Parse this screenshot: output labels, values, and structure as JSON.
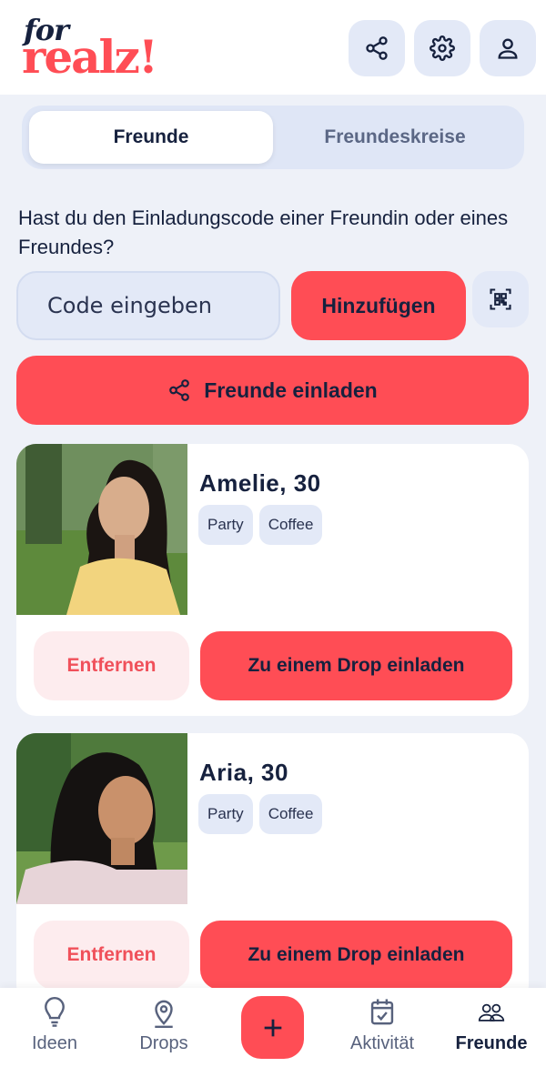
{
  "brand": {
    "line1": "for",
    "line2": "realz!"
  },
  "header": {
    "actions": [
      {
        "icon": "share-icon"
      },
      {
        "icon": "gear-icon"
      },
      {
        "icon": "user-icon"
      }
    ]
  },
  "tabs": {
    "friends": "Freunde",
    "circles": "Freundeskreise",
    "active": "Freunde"
  },
  "invite_section": {
    "prompt": "Hast du den Einladungscode einer Freundin oder eines Freundes?",
    "code_placeholder": "Code eingeben",
    "add_label": "Hinzufügen",
    "invite_label": "Freunde einladen"
  },
  "friends": [
    {
      "name": "Amelie, 30",
      "tags": [
        "Party",
        "Coffee"
      ],
      "remove_label": "Entfernen",
      "drop_label": "Zu einem Drop einladen"
    },
    {
      "name": "Aria, 30",
      "tags": [
        "Party",
        "Coffee"
      ],
      "remove_label": "Entfernen",
      "drop_label": "Zu einem Drop einladen"
    }
  ],
  "bottom_nav": {
    "items": [
      {
        "label": "Ideen",
        "icon": "lightbulb-icon"
      },
      {
        "label": "Drops",
        "icon": "location-pin-icon"
      },
      {
        "label": "Aktivität",
        "icon": "calendar-check-icon"
      },
      {
        "label": "Freunde",
        "icon": "users-icon"
      }
    ],
    "active": "Freunde"
  },
  "colors": {
    "accent": "#ff4d55",
    "navy": "#16213e",
    "soft_blue": "#e3e9f7",
    "background": "#eef1f8"
  }
}
